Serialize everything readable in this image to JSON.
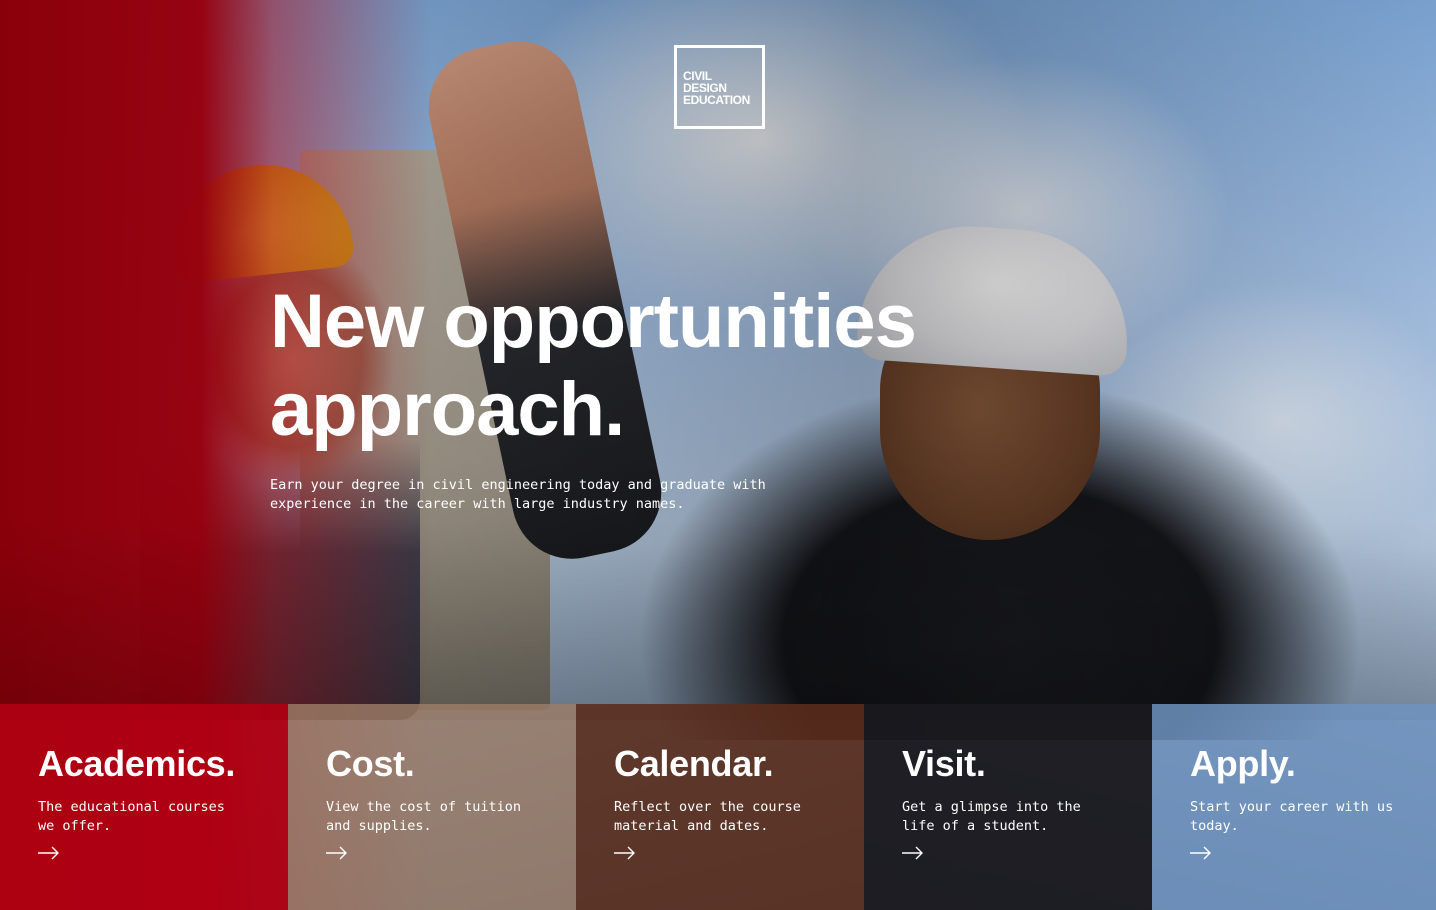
{
  "logo": {
    "text": "CIVIL\nDESIGN\nEDUCATION"
  },
  "hero": {
    "headline": "New opportunities approach.",
    "subtext": "Earn your degree in civil engineering today and graduate with experience in the career with large industry names."
  },
  "cards": [
    {
      "title": "Academics.",
      "description": "The educational courses we offer.",
      "color": "#B00012",
      "icon": "arrow-right-icon"
    },
    {
      "title": "Cost.",
      "description": "View the cost of tuition and supplies.",
      "color": "#9C7C66",
      "icon": "arrow-right-icon"
    },
    {
      "title": "Calendar.",
      "description": "Reflect over the course material and dates.",
      "color": "#5B2C1B",
      "icon": "arrow-right-icon"
    },
    {
      "title": "Visit.",
      "description": "Get a glimpse into the life of a student.",
      "color": "#1A191F",
      "icon": "arrow-right-icon"
    },
    {
      "title": "Apply.",
      "description": "Start your career with us today.",
      "color": "#6F93BF",
      "icon": "arrow-right-icon"
    }
  ]
}
